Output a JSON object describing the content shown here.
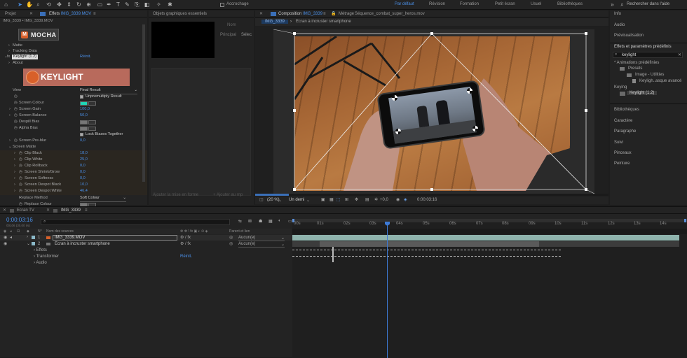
{
  "toolbar": {
    "snap_label": "Accrochage",
    "workspaces": [
      "Par défaut",
      "Révision",
      "Formation",
      "Petit écran",
      "Usuel",
      "Bibliothèques"
    ],
    "search_placeholder": "Rechercher dans l'aide"
  },
  "project_tab": "Projet",
  "effects_tab": {
    "prefix": "Effets",
    "file": "IMG_3339.MOV"
  },
  "effects_breadcrumb": "IMG_3339 • IMG_3339.MOV",
  "mocha": {
    "title": "MOCHA",
    "items": [
      "Matte",
      "Tracking Data"
    ]
  },
  "keylight": {
    "name": "Keylight (1.2)",
    "reset": "Réinit.",
    "about": "About",
    "logo": "KEYLIGHT",
    "view": {
      "label": "View",
      "value": "Final Result"
    },
    "unpremultiply": "Unpremultiply Result",
    "params": [
      {
        "label": "Screen Colour",
        "value": ""
      },
      {
        "label": "Screen Gain",
        "value": "100,0"
      },
      {
        "label": "Screen Balance",
        "value": "50,0"
      },
      {
        "label": "Despill Bias",
        "value": ""
      },
      {
        "label": "Alpha Bias",
        "value": ""
      }
    ],
    "lock_biases": "Lock Biases Together",
    "preblur": {
      "label": "Screen Pre-blur",
      "value": "0,0"
    },
    "matte": "Screen Matte",
    "matte_params": [
      {
        "label": "Clip Black",
        "value": "18,0"
      },
      {
        "label": "Clip White",
        "value": "25,0"
      },
      {
        "label": "Clip Rollback",
        "value": "0,0"
      },
      {
        "label": "Screen Shrink/Grow",
        "value": "0,0"
      },
      {
        "label": "Screen Softness",
        "value": "0,0"
      },
      {
        "label": "Screen Despot Black",
        "value": "10,0"
      },
      {
        "label": "Screen Despot White",
        "value": "46,4"
      }
    ],
    "replace_method": {
      "label": "Replace Method",
      "value": "Soft Colour"
    },
    "replace_colour": "Replace Colour"
  },
  "essential": {
    "title": "Objets graphiques essentiels",
    "nom": "Nom",
    "principal": "Principal",
    "select": "Sélec",
    "footer_left": "Ajouter la mise en forme",
    "footer_right": "+ Ajouter au mp"
  },
  "composition": {
    "title_prefix": "Composition",
    "title": "IMG_3339",
    "metrage": "Métrage",
    "metrage_file": "Séquence_combat_super_heros.mov",
    "tabs": [
      "IMG_3339",
      "Ecran à incruster smartphone"
    ],
    "zoom": "(20 %)",
    "resolution": "Un demi",
    "exposure": "+0,0",
    "timecode": "0:00:03:16"
  },
  "right_panel": {
    "info": "Info",
    "audio": "Audio",
    "preview": "Prévisualisation",
    "effects_presets": "Effets et paramètres prédéfinis",
    "search_value": "keylight",
    "tree": [
      "* Animations prédéfinies",
      "Presets",
      "Image - Utilities",
      "Keyligh..asque avancé",
      "Keying",
      "Keylight (1.2)"
    ],
    "sections": [
      "Bibliothèques",
      "Caractère",
      "Paragraphe",
      "Suivi",
      "Pinceaux",
      "Peinture"
    ]
  },
  "timeline": {
    "tabs": [
      "Ecran TV",
      "IMG_3339"
    ],
    "timecode": "0:00:03:16",
    "frame_info": "00106 (30,00 i/s)",
    "col_n": "N°",
    "col_source": "Nom des sources",
    "col_parent": "Parent et lien",
    "layers": [
      {
        "n": "1",
        "name": "IMG_3339.MOV",
        "parent": "Aucun(e)"
      },
      {
        "n": "2",
        "name": "Ecran à incruster smartphone",
        "parent": "Aucun(e)"
      }
    ],
    "sub": [
      "Effets",
      "Transformer",
      "Audio"
    ],
    "reset": "Réinit.",
    "ruler": [
      "00s",
      "01s",
      "02s",
      "03s",
      "04s",
      "05s",
      "06s",
      "07s",
      "08s",
      "09s",
      "10s",
      "11s",
      "12s",
      "13s",
      "14s"
    ]
  },
  "colors": {
    "accent": "#4a8fe7",
    "screen_colour": "#20d6b8",
    "keylight_logo_bg": "#b86a5c"
  }
}
